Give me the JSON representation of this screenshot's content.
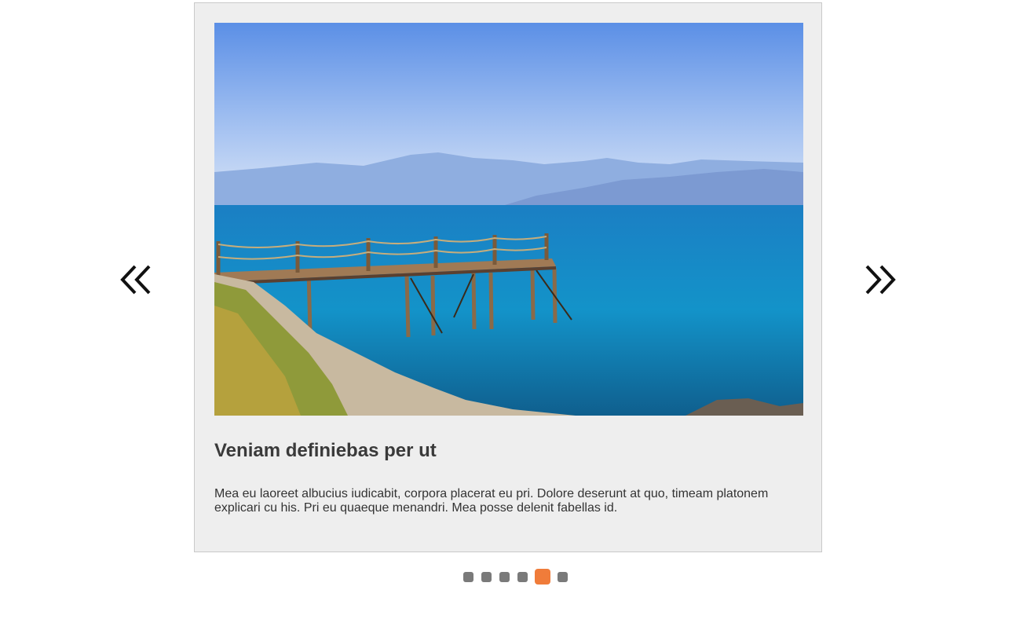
{
  "slider": {
    "title": "Veniam definiebas per ut",
    "text": "Mea eu laoreet albucius iudicabit, corpora placerat eu pri. Dolore deserunt at quo, timeam platonem explicari cu his. Pri eu quaeque menandri. Mea posse delenit fabellas id.",
    "image": "seascape-pier-photo",
    "prev_icon": "double-chevron-left-icon",
    "next_icon": "double-chevron-right-icon",
    "pager": {
      "count": 6,
      "active_index": 4
    },
    "colors": {
      "card_background": "#eeeeee",
      "dot_inactive": "#7a7a7a",
      "dot_active": "#f07c3a"
    }
  }
}
